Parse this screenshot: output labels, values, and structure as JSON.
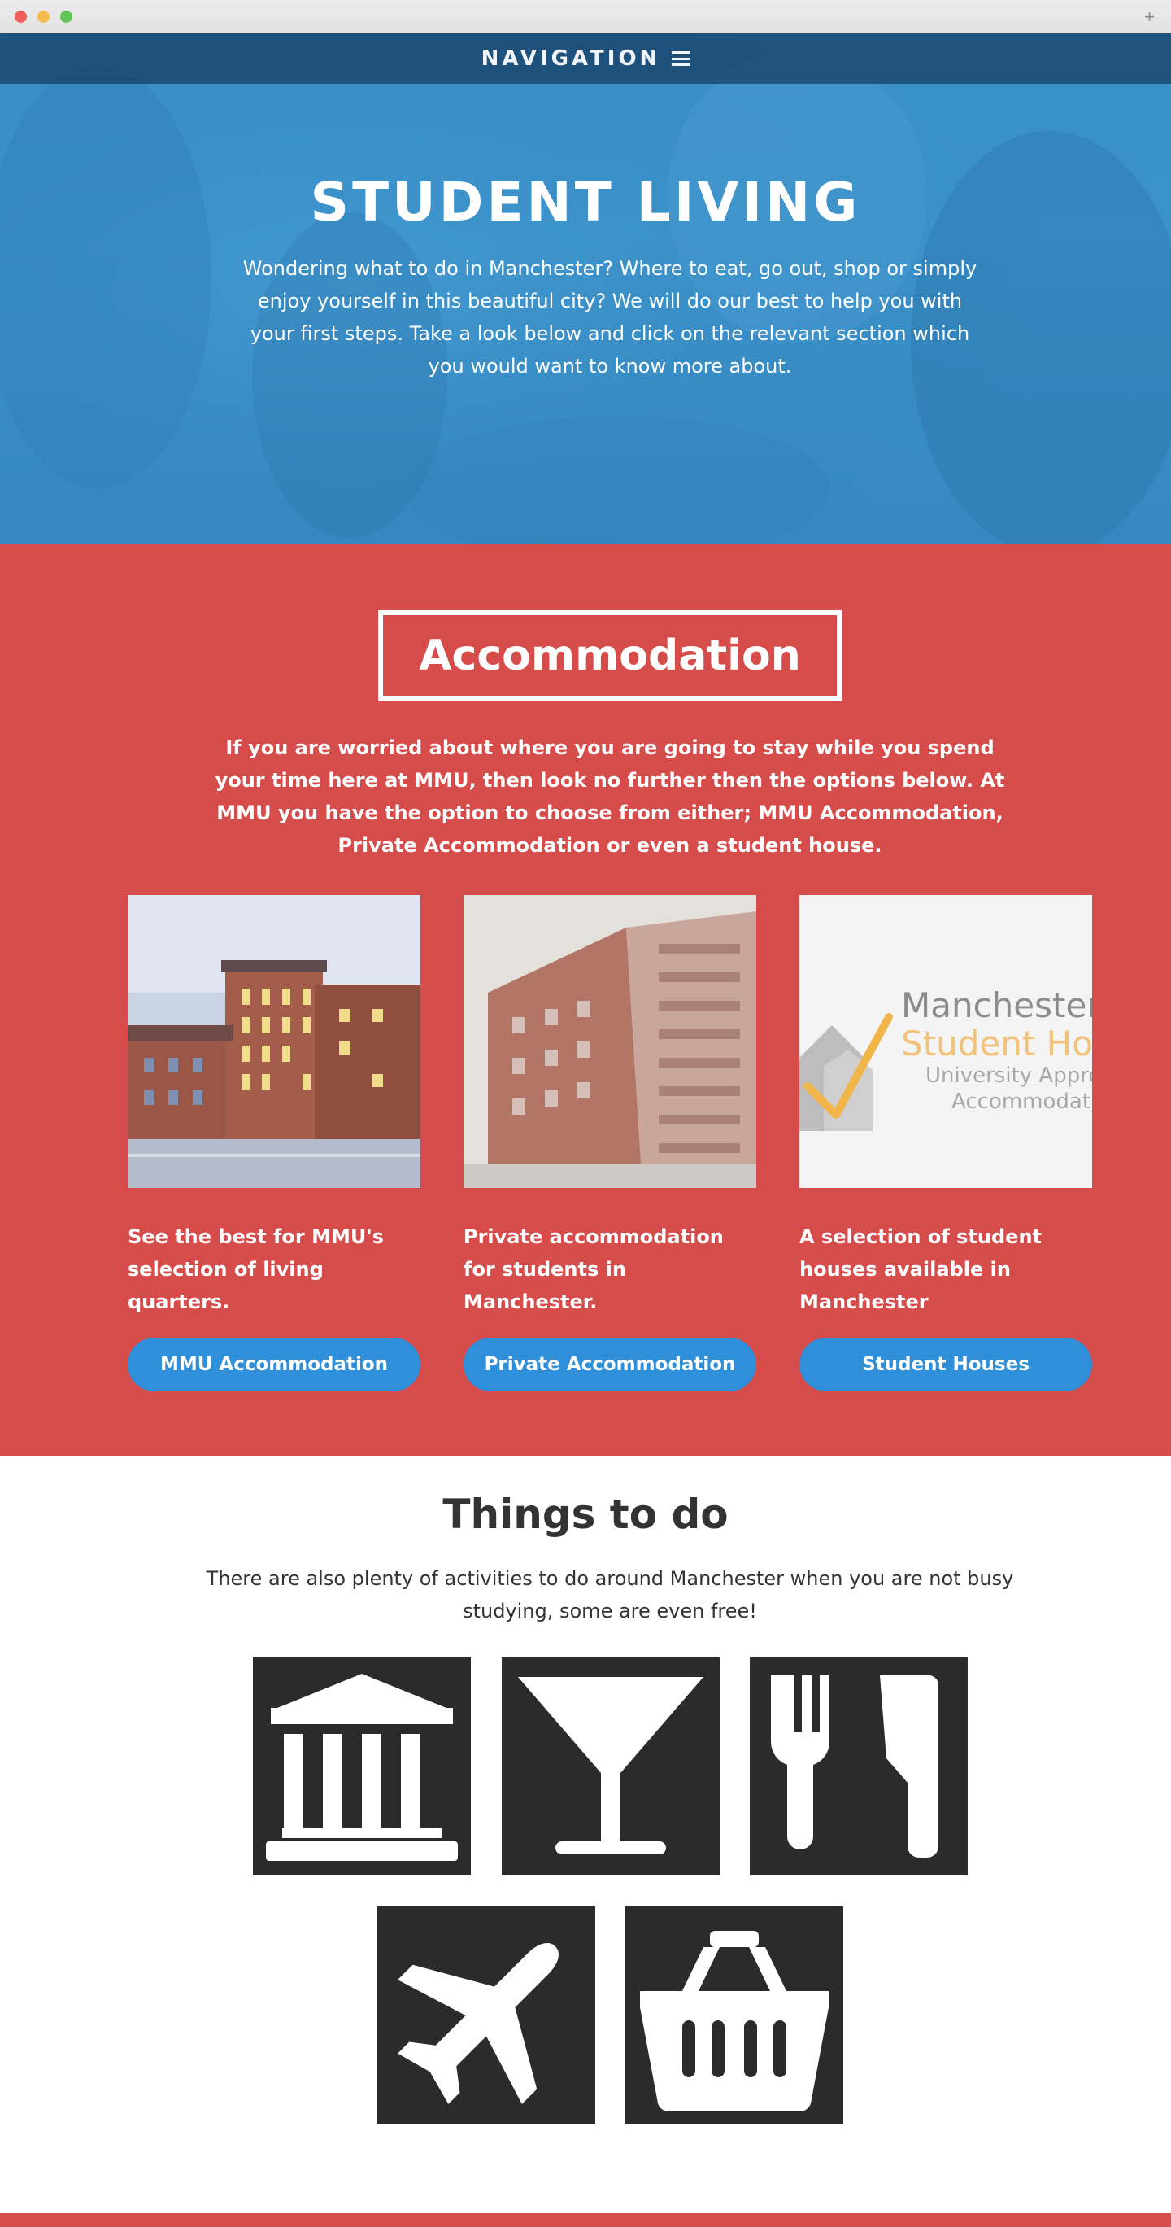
{
  "nav": {
    "label": "NAVIGATION"
  },
  "hero": {
    "title": "STUDENT LIVING",
    "text": "Wondering what to do in Manchester? Where to eat, go out, shop or simply enjoy yourself in this beautiful city? We will do our best to help you with your first steps. Take a look below and click on the relevant section which you would want to know more about."
  },
  "accommodation": {
    "title": "Accommodation",
    "intro": "If you are worried about where you are going to stay while you spend your time here at MMU, then look no further then the options below. At MMU you have the option to choose from either; MMU Accommodation, Private Accommodation or even a student house.",
    "cards": [
      {
        "description": "See the best for MMU's selection of living quarters.",
        "button": "MMU Accommodation"
      },
      {
        "description": "Private accommodation for students in Manchester.",
        "button": "Private Accommodation"
      },
      {
        "description": "A selection of student houses available in Manchester",
        "button": "Student Houses",
        "logo": {
          "line1": "Manchester",
          "line2": "Student Homes",
          "line3": "University Approved",
          "line4": "Accommodation"
        }
      }
    ]
  },
  "things": {
    "title": "Things to do",
    "text": "There are also plenty of activities to do around Manchester when you are not busy studying, some are even free!",
    "icons": [
      "museum-icon",
      "cocktail-icon",
      "restaurant-icon",
      "airplane-icon",
      "shopping-basket-icon"
    ]
  },
  "colors": {
    "hero_blue": "#3a8fc7",
    "accent_red": "#d64c4a",
    "button_blue": "#2f8fd8",
    "tile_dark": "#2b2b2b"
  }
}
